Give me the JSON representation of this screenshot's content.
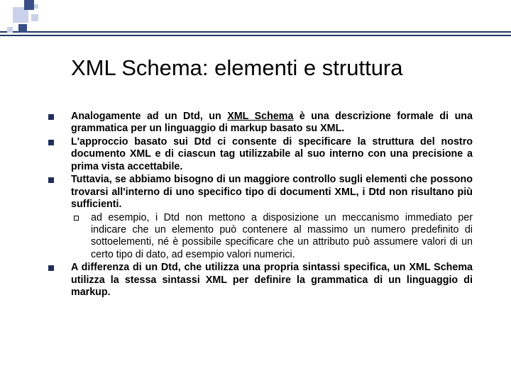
{
  "title": "XML Schema: elementi e struttura",
  "bullets": [
    {
      "pre": "Analogamente ad un Dtd, un ",
      "u": "XML Schema",
      "post": " è una descrizione formale di una grammatica per un linguaggio di markup basato su XML."
    },
    {
      "text": "L'approccio basato sui Dtd ci consente di specificare la struttura del nostro documento XML e di ciascun tag utilizzabile al suo interno con una precisione a prima vista accettabile."
    },
    {
      "text": "Tuttavia, se abbiamo bisogno di un maggiore controllo sugli elementi che possono trovarsi all'interno di uno specifico tipo di documenti XML, i Dtd non risultano più sufficienti.",
      "sub": [
        "ad esempio, i Dtd non mettono a disposizione un meccanismo immediato per indicare che un elemento può contenere al massimo un numero predefinito di sottoelementi, né è possibile specificare che un attributo può assumere valori di un certo tipo di dato, ad esempio valori numerici."
      ]
    },
    {
      "text": "A differenza di un Dtd, che utilizza una propria sintassi specifica, un XML Schema utilizza la stessa sintassi XML per definire la grammatica di un linguaggio di markup."
    }
  ]
}
